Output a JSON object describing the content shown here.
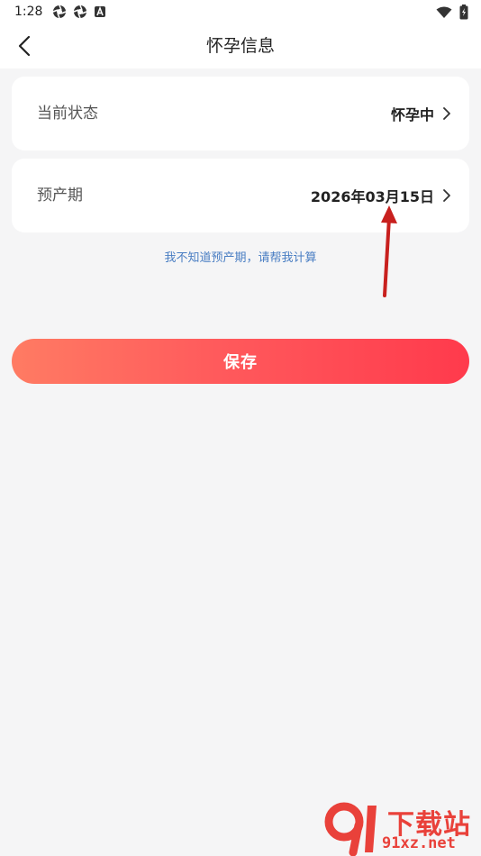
{
  "status_bar": {
    "time": "1:28"
  },
  "nav": {
    "title": "怀孕信息"
  },
  "status_card": {
    "label": "当前状态",
    "value": "怀孕中"
  },
  "due_date_card": {
    "label": "预产期",
    "value": "2026年03月15日"
  },
  "hint_link": "我不知道预产期，请帮我计算",
  "save_button_label": "保存",
  "watermark": {
    "text": "下载站",
    "url": "91xz.net"
  },
  "colors": {
    "accent_start": "#ff7b63",
    "accent_end": "#ff3a4c",
    "link": "#4a7ec3",
    "annotation_arrow": "#c8201e"
  }
}
